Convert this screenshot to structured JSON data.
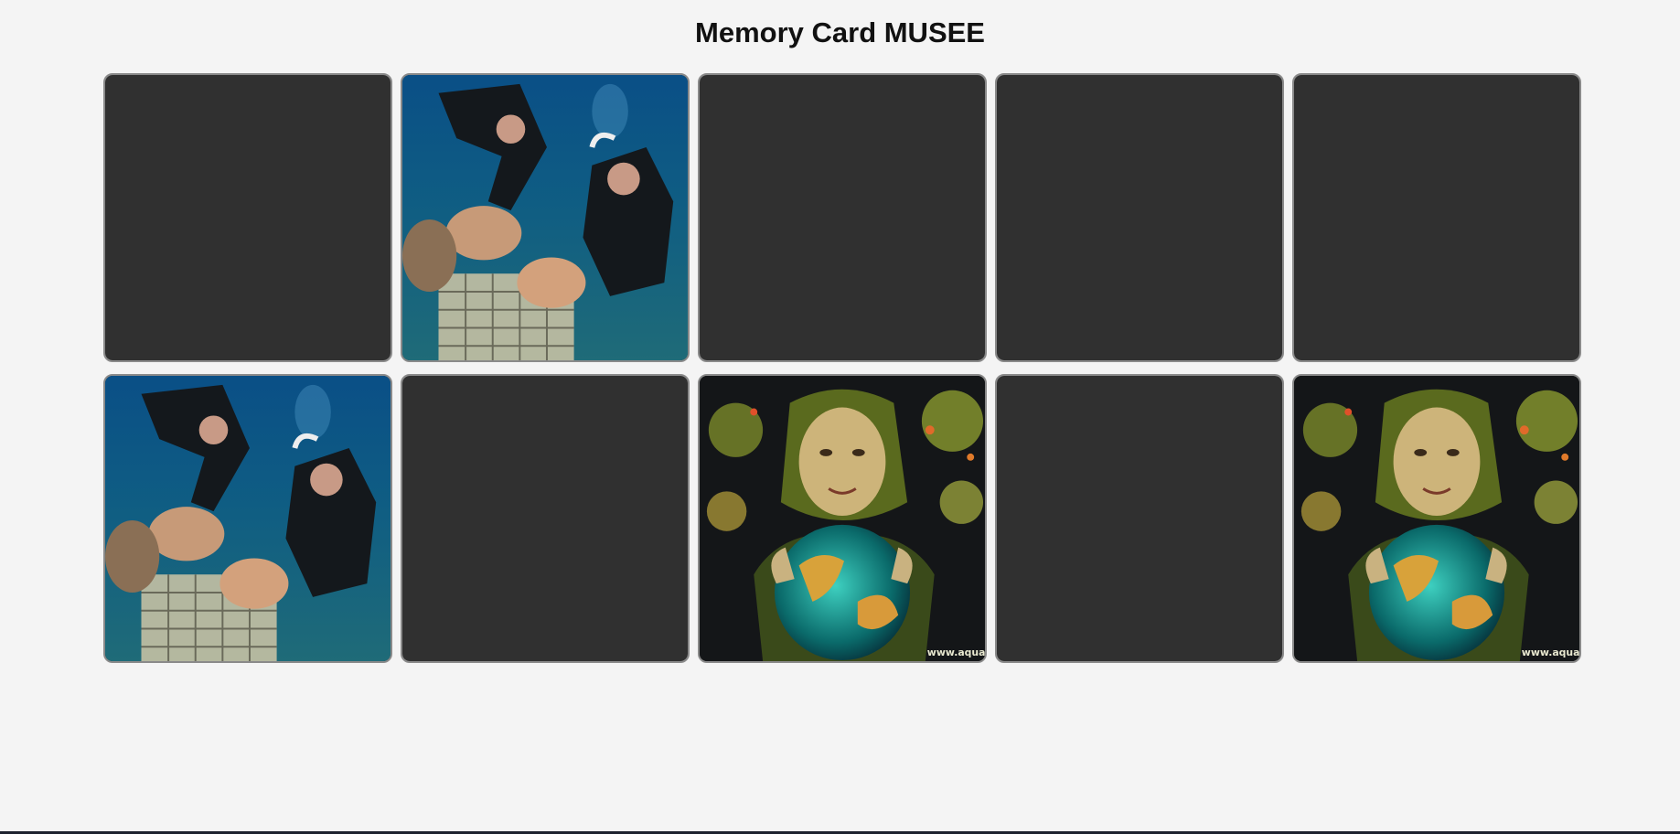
{
  "title": "Memory Card MUSEE",
  "cards": [
    {
      "state": "hidden"
    },
    {
      "state": "revealed",
      "image": "coral-divers"
    },
    {
      "state": "hidden"
    },
    {
      "state": "hidden"
    },
    {
      "state": "hidden"
    },
    {
      "state": "revealed",
      "image": "coral-divers"
    },
    {
      "state": "hidden"
    },
    {
      "state": "revealed",
      "image": "earth-goddess",
      "watermark": "www.aqua"
    },
    {
      "state": "hidden"
    },
    {
      "state": "revealed",
      "image": "earth-goddess",
      "watermark": "www.aqua"
    }
  ],
  "colors": {
    "background": "#f4f4f4",
    "card_back": "#303030",
    "card_border": "#8a8a8a"
  }
}
